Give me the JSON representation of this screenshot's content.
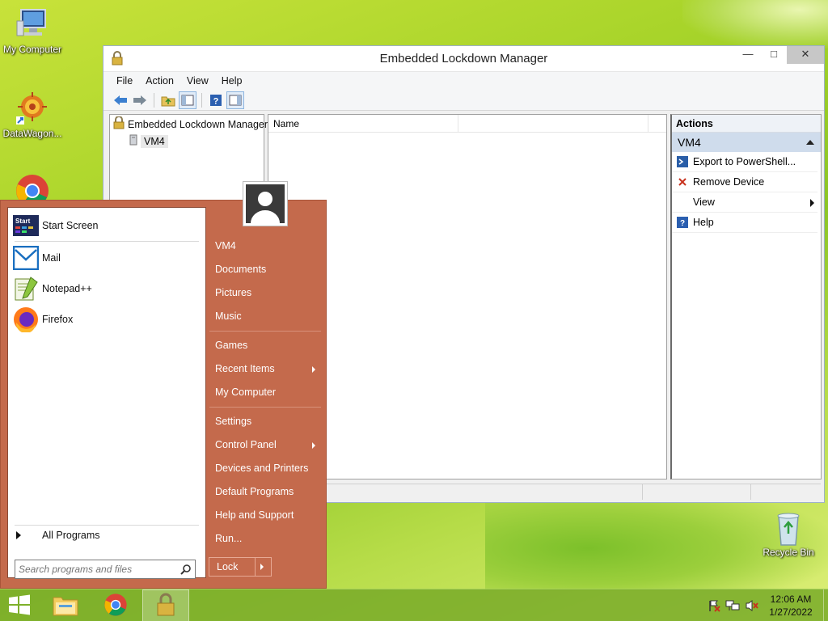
{
  "desktop": {
    "icons": [
      {
        "label": "My Computer"
      },
      {
        "label": "DataWagon..."
      },
      {
        "label": "Google Chrome"
      },
      {
        "label": "Recycle Bin"
      }
    ]
  },
  "window": {
    "title": "Embedded Lockdown Manager",
    "minimize": "—",
    "maximize": "□",
    "close": "✕",
    "menu": [
      "File",
      "Action",
      "View",
      "Help"
    ],
    "tree": {
      "root": "Embedded Lockdown Manager",
      "child": "VM4"
    },
    "list": {
      "columns": [
        "Name",
        ""
      ]
    },
    "actions": {
      "header": "Actions",
      "section": "VM4",
      "items": [
        {
          "label": "Export to PowerShell...",
          "icon": "powershell-icon"
        },
        {
          "label": "Remove Device",
          "icon": "delete-x-icon"
        },
        {
          "label": "View",
          "icon": ""
        },
        {
          "label": "Help",
          "icon": "help-icon"
        }
      ]
    }
  },
  "start_menu": {
    "pinned": [
      {
        "label": "Start Screen",
        "icon": "start-screen-icon",
        "icon_text": "Start"
      },
      {
        "label": "Mail",
        "icon": "mail-icon"
      },
      {
        "label": "Notepad++",
        "icon": "notepadpp-icon"
      },
      {
        "label": "Firefox",
        "icon": "firefox-icon"
      }
    ],
    "all_programs": "All Programs",
    "search_placeholder": "Search programs and files",
    "right_items": [
      {
        "label": "VM4"
      },
      {
        "label": "Documents"
      },
      {
        "label": "Pictures"
      },
      {
        "label": "Music"
      },
      {
        "label": "Games"
      },
      {
        "label": "Recent Items",
        "submenu": true
      },
      {
        "label": "My Computer"
      },
      {
        "label": "Settings"
      },
      {
        "label": "Control Panel",
        "submenu": true
      },
      {
        "label": "Devices and Printers"
      },
      {
        "label": "Default Programs"
      },
      {
        "label": "Help and Support"
      },
      {
        "label": "Run..."
      }
    ],
    "lock_label": "Lock"
  },
  "taskbar": {
    "clock_time": "12:06 AM",
    "clock_date": "1/27/2022"
  },
  "colors": {
    "start_menu_bg": "#c46a4c",
    "actions_section_bg": "#cfdcec"
  }
}
